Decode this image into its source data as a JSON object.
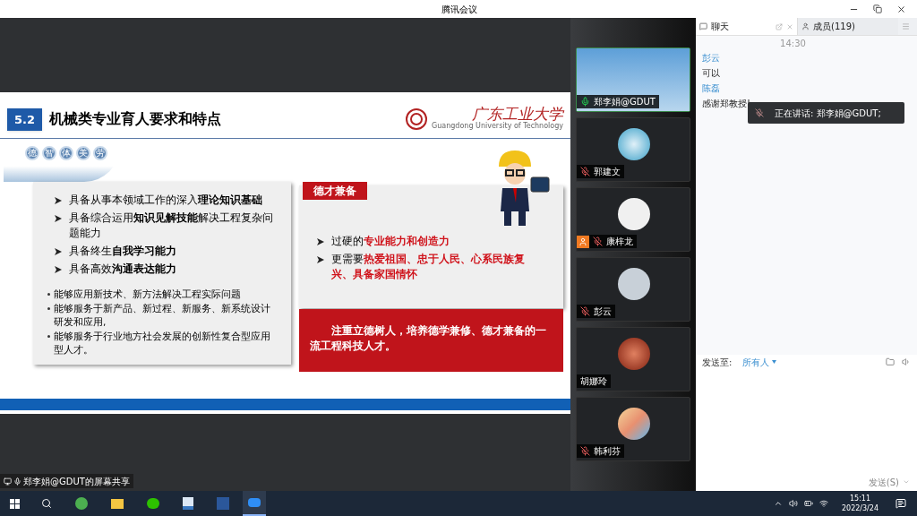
{
  "window": {
    "title": "腾讯会议"
  },
  "slide": {
    "section": "5.2",
    "title": "机械类专业育人要求和特点",
    "logo": {
      "name": "广东工业大学",
      "subtitle": "Guangdong University of Technology"
    },
    "banner": [
      "德",
      "智",
      "体",
      "美",
      "劳"
    ],
    "left_points": [
      "具备从事本领域工作的深入**理论知识基础**",
      "具备综合运用**知识见解技能**解决工程复杂问题能力",
      "具备终生**自我学习能力**",
      "具备高效**沟通表达能力**"
    ],
    "left_notes": [
      "能够应用新技术、新方法解决工程实际问题",
      "能够服务于新产品、新过程、新服务、新系统设计研发和应用,",
      "能够服务于行业地方社会发展的创新性复合型应用型人才。"
    ],
    "right_box": {
      "heading": "德才兼备",
      "points": [
        "过硬的**专业能力和创造力**",
        "更需要**热爱祖国、忠于人民、心系民族复兴、具备家国情怀**"
      ]
    },
    "conclusion": "注重立德树人，培养德学兼修、德才兼备的一流工程科技人才。"
  },
  "videos": [
    {
      "name": "郑李娟@GDUT",
      "kind": "video",
      "mic_shown": true,
      "mic_muted": false,
      "host": false
    },
    {
      "name": "郭建文",
      "kind": "avatar",
      "mic_shown": true,
      "mic_muted": true,
      "host": false
    },
    {
      "name": "康梓龙",
      "kind": "avatar",
      "mic_shown": true,
      "mic_muted": true,
      "host": true
    },
    {
      "name": "彭云",
      "kind": "avatar",
      "mic_shown": true,
      "mic_muted": true,
      "host": false
    },
    {
      "name": "胡娜玲",
      "kind": "avatar",
      "mic_shown": false,
      "host": false
    },
    {
      "name": "韩利芬",
      "kind": "avatar",
      "mic_shown": true,
      "mic_muted": true,
      "host": false
    }
  ],
  "chat": {
    "tabs": [
      {
        "label": "聊天",
        "selected": true
      },
      {
        "label": "成员(119)",
        "selected": false
      }
    ],
    "time": "14:30",
    "messages": [
      {
        "sender": "彭云",
        "text": "可以"
      },
      {
        "sender": "陈磊",
        "text": "感谢郑教授!"
      }
    ],
    "speaking_toast": "正在讲话: 郑李娟@GDUT;",
    "send_to_label": "发送至:",
    "recipient": "所有人",
    "send_button": "发送(S)"
  },
  "share_label": "郑李娟@GDUT的屏幕共享",
  "taskbar": {
    "time": "15:11",
    "date": "2022/3/24"
  }
}
